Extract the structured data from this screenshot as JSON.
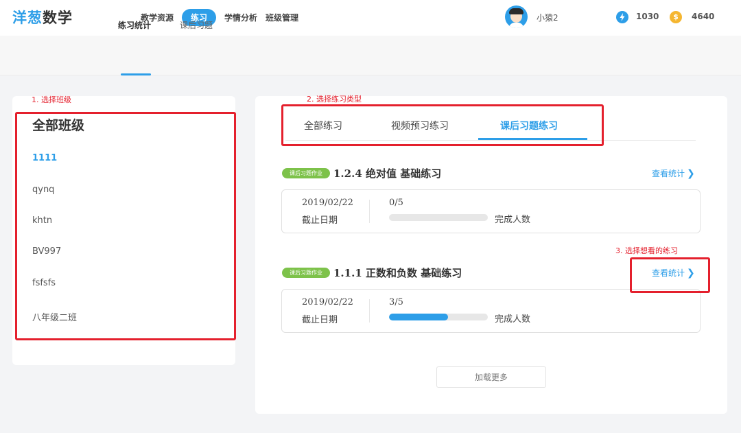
{
  "header": {
    "logo_part1": "洋葱",
    "logo_part2": "数学",
    "nav": [
      {
        "label": "教学资源"
      },
      {
        "label": "练习",
        "active": true
      },
      {
        "label": "学情分析"
      },
      {
        "label": "班级管理"
      }
    ],
    "username": "小猿2",
    "energy_icon": "lightning-icon",
    "energy_value": "1030",
    "coin_icon": "dollar-coin-icon",
    "coin_symbol": "$",
    "coin_value": "4640"
  },
  "subnav": {
    "tabs": [
      {
        "label": "练习统计",
        "active": true
      },
      {
        "label": "课后习题"
      }
    ]
  },
  "class_panel": {
    "title": "全部班级",
    "classes": [
      "1111",
      "qynq",
      "khtn",
      "BV997",
      "fsfsfs",
      "八年级二班"
    ],
    "selected": "1111"
  },
  "exercise_panel": {
    "type_tabs": [
      {
        "label": "全部练习"
      },
      {
        "label": "视频预习练习"
      },
      {
        "label": "课后习题练习",
        "active": true
      }
    ],
    "exercises": [
      {
        "badge": "课后习题作业",
        "title": "1.2.4 绝对值 基础练习",
        "link": "查看统计",
        "date": "2019/02/22",
        "date_label": "截止日期",
        "count": "0/5",
        "completed": 0,
        "total": 5,
        "count_label": "完成人数"
      },
      {
        "badge": "课后习题作业",
        "title": "1.1.1 正数和负数 基础练习",
        "link": "查看统计",
        "date": "2019/02/22",
        "date_label": "截止日期",
        "count": "3/5",
        "completed": 3,
        "total": 5,
        "count_label": "完成人数"
      }
    ],
    "load_more": "加载更多"
  },
  "annotations": {
    "step1": "1. 选择班级",
    "step2": "2. 选择练习类型",
    "step3": "3. 选择想看的练习",
    "color": "#e4202d"
  },
  "colors": {
    "accent": "#2d9ee8",
    "badge_green": "#7dc24a",
    "coin_gold": "#f5b630"
  }
}
